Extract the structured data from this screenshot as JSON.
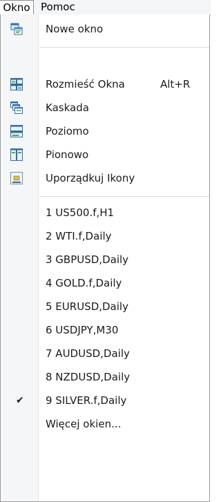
{
  "menubar": {
    "okno": "Okno",
    "pomoc": "Pomoc"
  },
  "menu": {
    "nowe_okno": "Nowe okno",
    "rozmiesc": "Rozmieść Okna",
    "rozmiesc_shortcut": "Alt+R",
    "kaskada": "Kaskada",
    "poziomo": "Poziomo",
    "pionowo": "Pionowo",
    "uporzadkuj": "Uporządkuj Ikony",
    "windows": [
      "1 US500.f,H1",
      "2 WTI.f,Daily",
      "3 GBPUSD,Daily",
      "4 GOLD.f,Daily",
      "5 EURUSD,Daily",
      "6 USDJPY,M30",
      "7 AUDUSD,Daily",
      "8 NZDUSD,Daily",
      "9 SILVER.f,Daily"
    ],
    "checked_window_index": 8,
    "check_mark": "✔",
    "wiecej": "Więcej okien..."
  }
}
